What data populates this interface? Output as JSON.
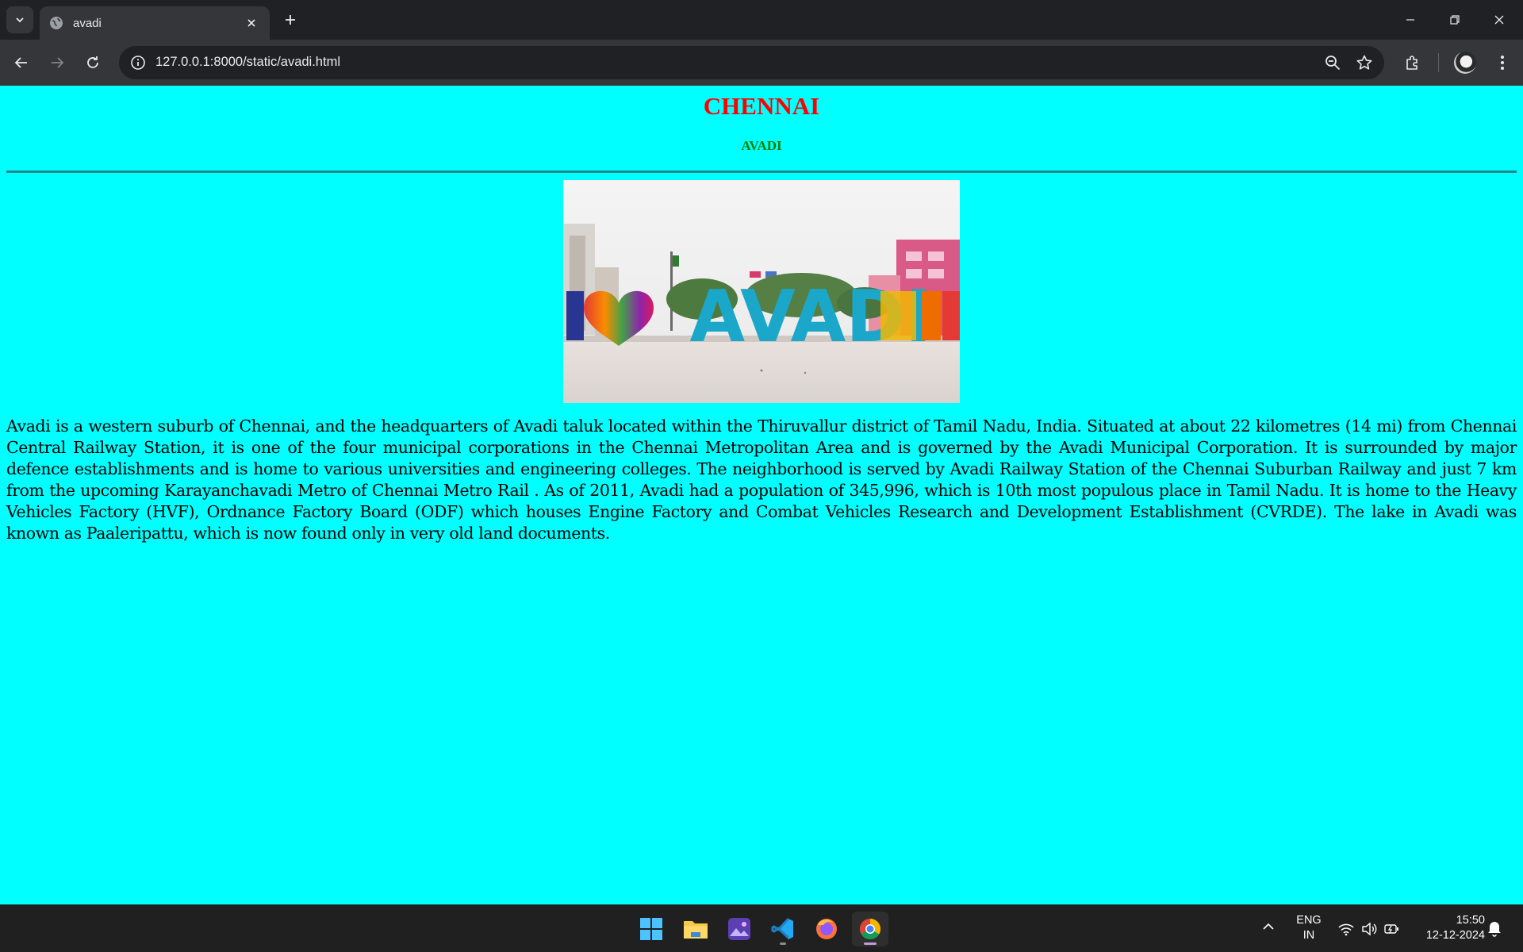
{
  "browser": {
    "tab_title": "avadi",
    "url": "127.0.0.1:8000/static/avadi.html"
  },
  "page": {
    "heading": "CHENNAI",
    "subheading": "AVADI",
    "image_text": "AVADI",
    "background": "#00ffff",
    "heading_color": "#ff0000",
    "subheading_color": "#008000",
    "paragraph": "Avadi is a western suburb of Chennai, and the headquarters of Avadi taluk located within the Thiruvallur district of Tamil Nadu, India. Situated at about 22 kilometres (14 mi) from Chennai Central Railway Station, it is one of the four municipal corporations in the Chennai Metropolitan Area and is governed by the Avadi Municipal Corporation. It is surrounded by major defence establishments and is home to various universities and engineering colleges. The neighborhood is served by Avadi Railway Station of the Chennai Suburban Railway and just 7 km from the upcoming Karayanchavadi Metro of Chennai Metro Rail . As of 2011, Avadi had a population of 345,996, which is 10th most populous place in Tamil Nadu. It is home to the Heavy Vehicles Factory (HVF), Ordnance Factory Board (ODF) which houses Engine Factory and Combat Vehicles Research and Development Establishment (CVRDE). The lake in Avadi was known as Paaleripattu, which is now found only in very old land documents."
  },
  "taskbar": {
    "apps": [
      "windows-start",
      "file-explorer",
      "photo-app",
      "vscode",
      "firefox",
      "chrome"
    ],
    "lang_top": "ENG",
    "lang_bottom": "IN",
    "time": "15:50",
    "date": "12-12-2024"
  }
}
